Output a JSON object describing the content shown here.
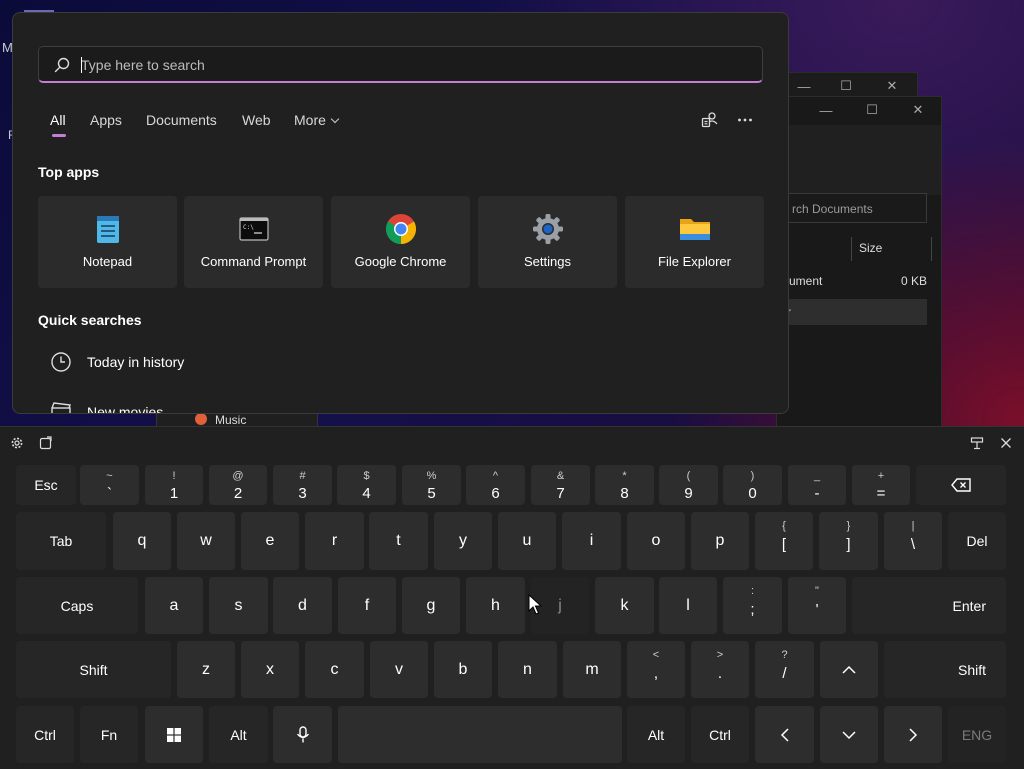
{
  "background": {
    "edge_letter_m": "M",
    "edge_letter_f": "F",
    "explorer": {
      "search_placeholder": "rch Documents",
      "column_size": "Size",
      "file_name": "ument",
      "file_size": "0 KB",
      "row2_text": "r"
    },
    "taskbar_item": "Music"
  },
  "search_panel": {
    "search_placeholder": "Type here to search",
    "search_value": "",
    "tabs": [
      "All",
      "Apps",
      "Documents",
      "Web",
      "More"
    ],
    "active_tab": "All",
    "accent_color": "#c47ed6",
    "top_apps_title": "Top apps",
    "top_apps": [
      {
        "label": "Notepad",
        "icon": "notepad-icon"
      },
      {
        "label": "Command Prompt",
        "icon": "command-prompt-icon"
      },
      {
        "label": "Google Chrome",
        "icon": "chrome-icon"
      },
      {
        "label": "Settings",
        "icon": "settings-gear-icon"
      },
      {
        "label": "File Explorer",
        "icon": "folder-icon"
      }
    ],
    "quick_searches_title": "Quick searches",
    "quick_searches": [
      {
        "label": "Today in history",
        "icon": "clock-icon"
      },
      {
        "label": "New movies",
        "icon": "clapperboard-icon"
      }
    ]
  },
  "keyboard": {
    "row1": [
      {
        "shift": "",
        "main": "Esc"
      },
      {
        "shift": "~",
        "main": "`"
      },
      {
        "shift": "!",
        "main": "1"
      },
      {
        "shift": "@",
        "main": "2"
      },
      {
        "shift": "#",
        "main": "3"
      },
      {
        "shift": "$",
        "main": "4"
      },
      {
        "shift": "%",
        "main": "5"
      },
      {
        "shift": "^",
        "main": "6"
      },
      {
        "shift": "&",
        "main": "7"
      },
      {
        "shift": "*",
        "main": "8"
      },
      {
        "shift": "(",
        "main": "9"
      },
      {
        "shift": ")",
        "main": "0"
      },
      {
        "shift": "_",
        "main": "-"
      },
      {
        "shift": "+",
        "main": "="
      },
      {
        "shift": "",
        "main": "⌫"
      }
    ],
    "row2": [
      {
        "shift": "",
        "main": "Tab"
      },
      {
        "shift": "",
        "main": "q"
      },
      {
        "shift": "",
        "main": "w"
      },
      {
        "shift": "",
        "main": "e"
      },
      {
        "shift": "",
        "main": "r"
      },
      {
        "shift": "",
        "main": "t"
      },
      {
        "shift": "",
        "main": "y"
      },
      {
        "shift": "",
        "main": "u"
      },
      {
        "shift": "",
        "main": "i"
      },
      {
        "shift": "",
        "main": "o"
      },
      {
        "shift": "",
        "main": "p"
      },
      {
        "shift": "{",
        "main": "["
      },
      {
        "shift": "}",
        "main": "]"
      },
      {
        "shift": "|",
        "main": "\\"
      },
      {
        "shift": "",
        "main": "Del"
      }
    ],
    "row3": [
      {
        "shift": "",
        "main": "Caps"
      },
      {
        "shift": "",
        "main": "a"
      },
      {
        "shift": "",
        "main": "s"
      },
      {
        "shift": "",
        "main": "d"
      },
      {
        "shift": "",
        "main": "f"
      },
      {
        "shift": "",
        "main": "g"
      },
      {
        "shift": "",
        "main": "h"
      },
      {
        "shift": "",
        "main": "j"
      },
      {
        "shift": "",
        "main": "k"
      },
      {
        "shift": "",
        "main": "l"
      },
      {
        "shift": ":",
        "main": ";"
      },
      {
        "shift": "\"",
        "main": "'"
      },
      {
        "shift": "",
        "main": "Enter"
      }
    ],
    "row4": [
      {
        "shift": "",
        "main": "Shift"
      },
      {
        "shift": "",
        "main": "z"
      },
      {
        "shift": "",
        "main": "x"
      },
      {
        "shift": "",
        "main": "c"
      },
      {
        "shift": "",
        "main": "v"
      },
      {
        "shift": "",
        "main": "b"
      },
      {
        "shift": "",
        "main": "n"
      },
      {
        "shift": "",
        "main": "m"
      },
      {
        "shift": "<",
        "main": ","
      },
      {
        "shift": ">",
        "main": "."
      },
      {
        "shift": "?",
        "main": "/"
      },
      {
        "shift": "",
        "main": "^"
      },
      {
        "shift": "",
        "main": "Shift"
      }
    ],
    "row5": [
      {
        "shift": "",
        "main": "Ctrl"
      },
      {
        "shift": "",
        "main": "Fn"
      },
      {
        "shift": "",
        "main": "windows-icon"
      },
      {
        "shift": "",
        "main": "Alt"
      },
      {
        "shift": "",
        "main": "microphone-icon"
      },
      {
        "shift": "",
        "main": ""
      },
      {
        "shift": "",
        "main": "Alt"
      },
      {
        "shift": "",
        "main": "Ctrl"
      },
      {
        "shift": "",
        "main": "<"
      },
      {
        "shift": "",
        "main": "v"
      },
      {
        "shift": "",
        "main": ">"
      },
      {
        "shift": "",
        "main": "ENG"
      }
    ]
  }
}
